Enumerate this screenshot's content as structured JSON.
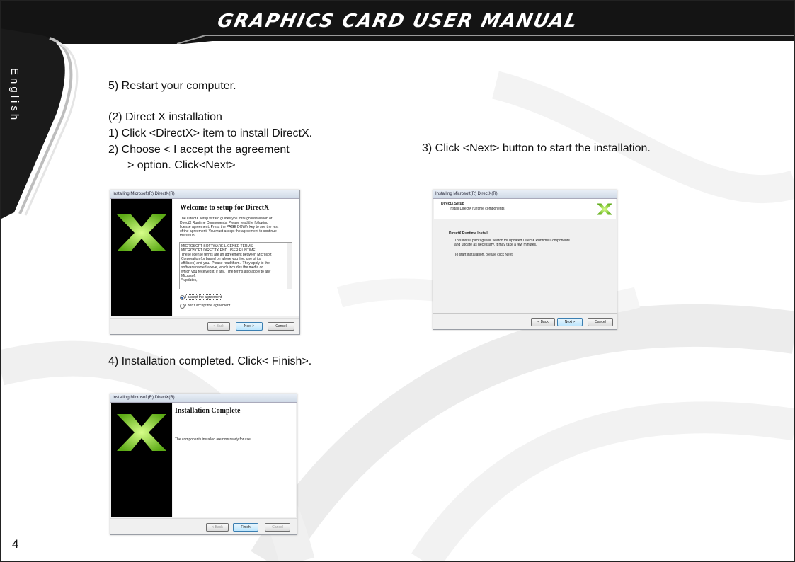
{
  "header": {
    "title": "Graphics Card User Manual"
  },
  "side_tab": {
    "label": "English"
  },
  "page_number": "4",
  "content": {
    "step5_restart": "5) Restart your computer.",
    "section_title": "(2) Direct X installation",
    "step1": "1) Click <DirectX> item to install DirectX.",
    "step2_line1": "2) Choose < I accept the agreement",
    "step2_line2": "> option. Click<Next>",
    "step3": "3) Click <Next> button to start the installation.",
    "step4": "4) Installation completed. Click< Finish>."
  },
  "dialog_welcome": {
    "window_title": "Installing Microsoft(R) DirectX(R)",
    "heading": "Welcome to setup for DirectX",
    "intro": "The DirectX setup wizard guides you through installation of\nDirectX Runtime Components. Please read the following\nlicense agreement. Press the PAGE DOWN key to see the rest\nof the agreement. You must accept the agreement to continue\nthe setup.",
    "license_text": "MICROSOFT SOFTWARE LICENSE TERMS\nMICROSOFT DIRECTX END USER RUNTIME\nThese license terms are an agreement between Microsoft\nCorporation (or based on where you live, one of its\naffiliates) and you.  Please read them.  They apply to the\nsoftware named above, which includes the media on\nwhich you received it, if any.  The terms also apply to any\nMicrosoft\n* updates,",
    "radio_accept": "I accept the agreement",
    "radio_decline": "I don't accept the agreement",
    "btn_back": "< Back",
    "btn_next": "Next >",
    "btn_cancel": "Cancel"
  },
  "dialog_setup": {
    "window_title": "Installing Microsoft(R) DirectX(R)",
    "heading": "DirectX Setup",
    "subheading": "Install DirectX runtime components",
    "section": "DirectX Runtime Install:",
    "desc": "This install package will search for updated DirectX Runtime Components\nand update as necessary. It may take a few minutes.",
    "instruction": "To start installation, please click Next.",
    "btn_back": "< Back",
    "btn_next": "Next >",
    "btn_cancel": "Cancel"
  },
  "dialog_complete": {
    "window_title": "Installing Microsoft(R) DirectX(R)",
    "heading": "Installation Complete",
    "message": "The components installed are now ready for use.",
    "btn_back": "< Back",
    "btn_finish": "Finish",
    "btn_cancel": "Cancel"
  },
  "colors": {
    "header_bg": "#111111",
    "side_tab_bg": "#1a1a1a",
    "directx_green": "#8fd63a",
    "dialog_panel_bg": "#000000"
  }
}
